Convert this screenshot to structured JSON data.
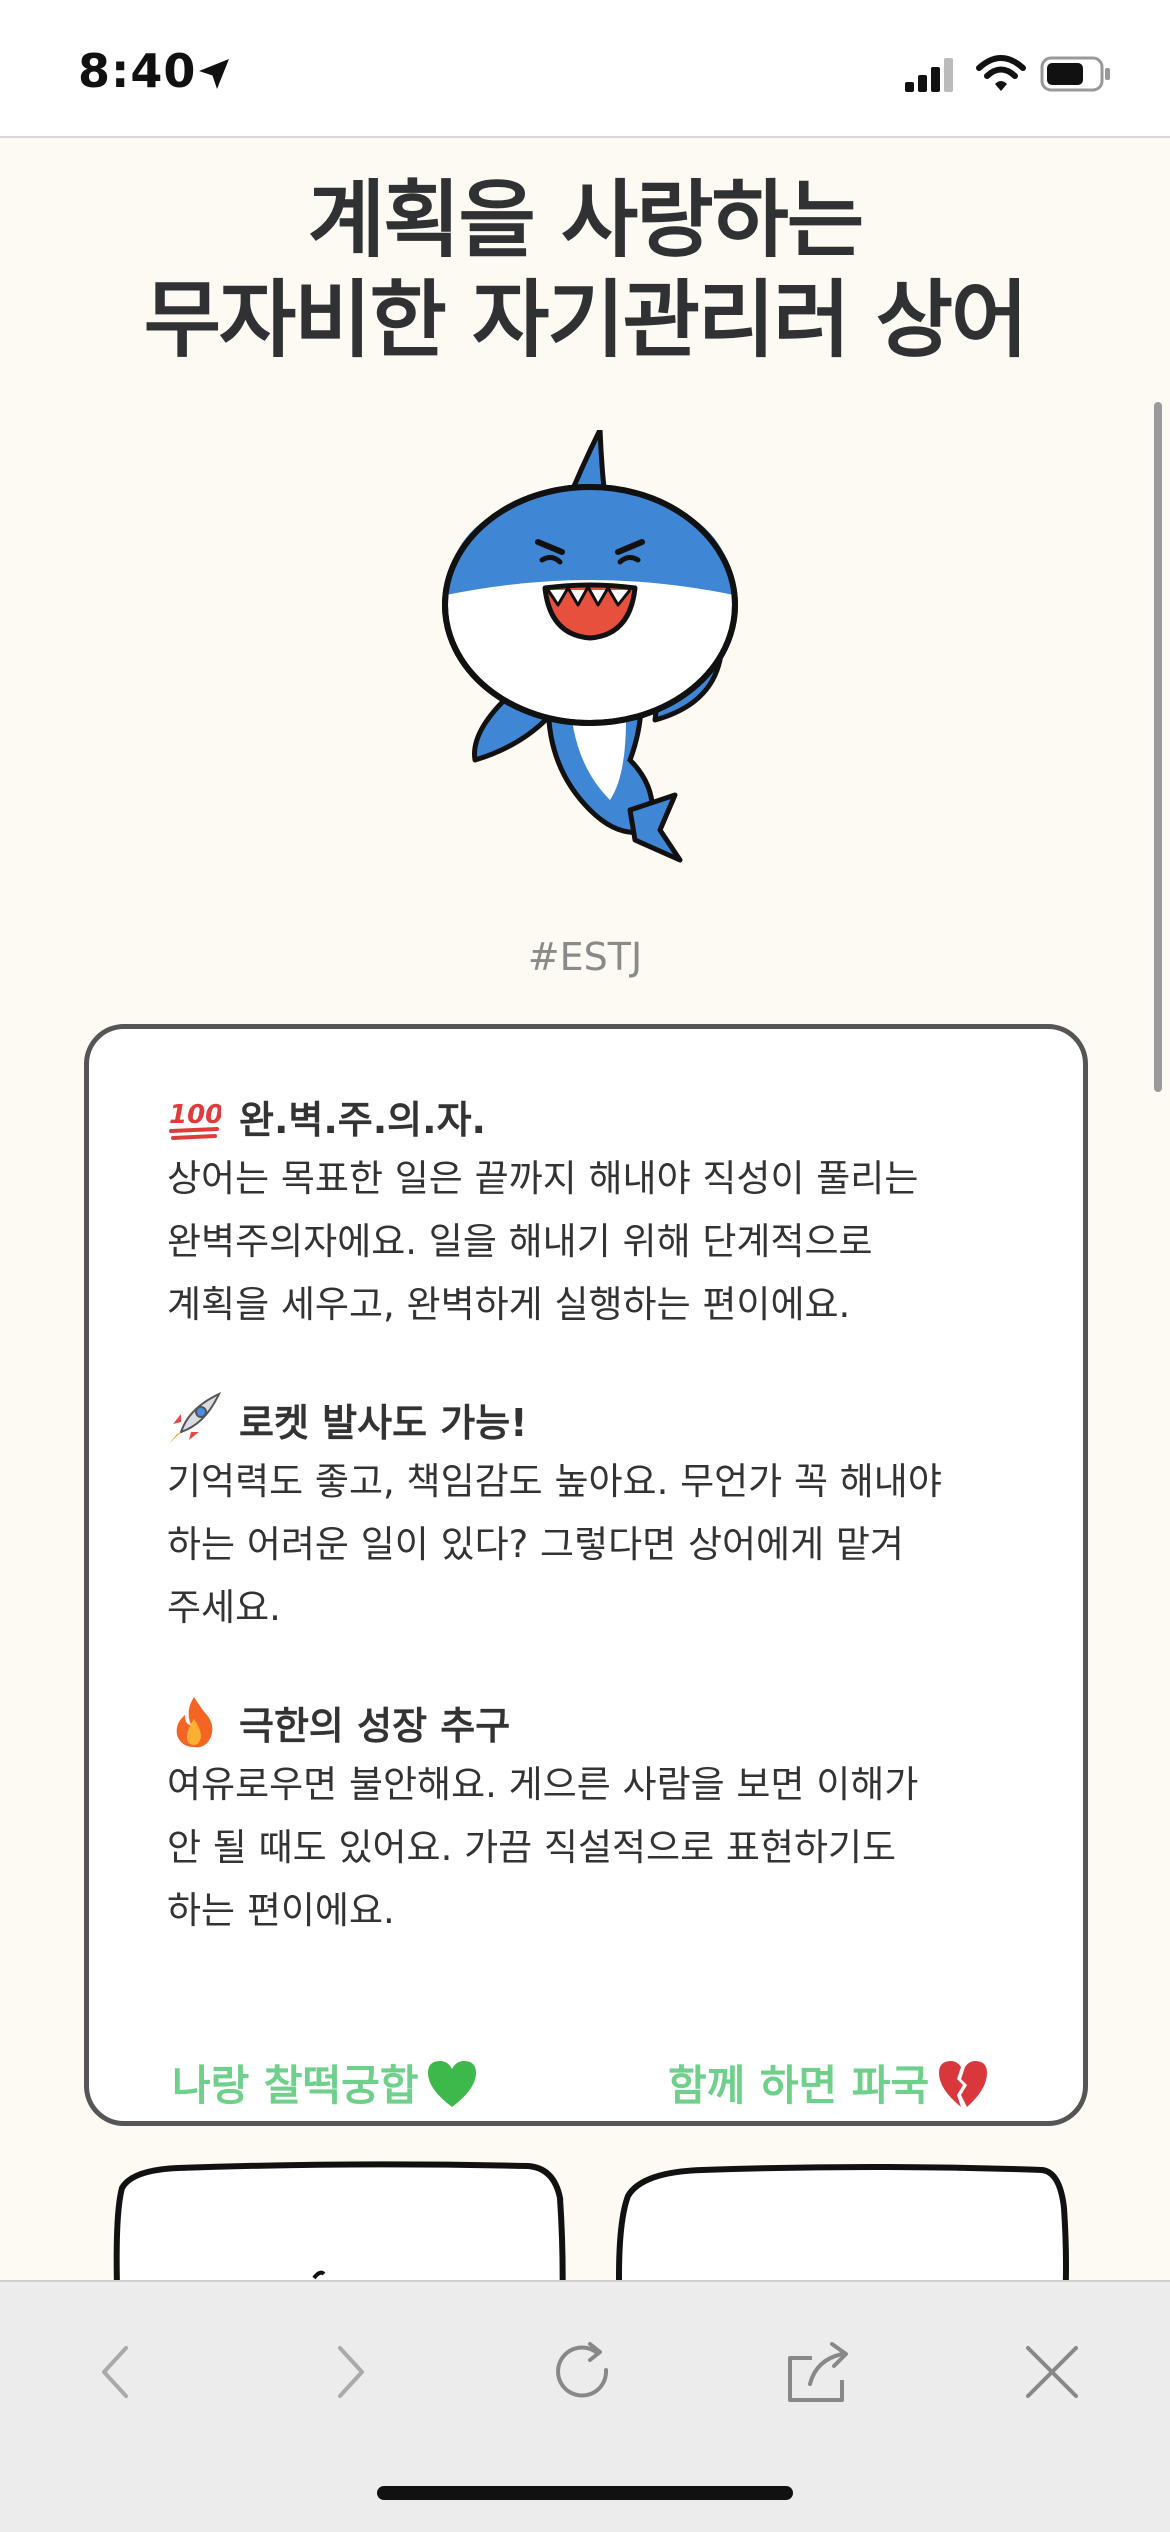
{
  "status": {
    "time": "8:40"
  },
  "title": {
    "line1": "계획을 사랑하는",
    "line2": "무자비한 자기관리러 상어"
  },
  "hashtag": "#ESTJ",
  "sections": [
    {
      "emoji": "hundred-points-icon",
      "heading": "완.벽.주.의.자.",
      "lines": [
        "상어는 목표한 일은 끝까지 해내야 직성이 풀리는",
        "완벽주의자에요. 일을 해내기 위해 단계적으로",
        "계획을 세우고, 완벽하게 실행하는 편이에요."
      ]
    },
    {
      "emoji": "rocket-icon",
      "heading": "로켓 발사도 가능!",
      "lines": [
        "기억력도 좋고, 책임감도 높아요. 무언가 꼭 해내야",
        "하는 어려운 일이 있다? 그렇다면 상어에게 맡겨",
        "주세요."
      ]
    },
    {
      "emoji": "fire-icon",
      "heading": "극한의 성장 추구",
      "lines": [
        "여유로우면 불안해요. 게으른 사람을 보면 이해가",
        "안 될 때도 있어요. 가끔 직설적으로 표현하기도",
        "하는 편이에요."
      ]
    }
  ],
  "match": {
    "good": "나랑 찰떡궁합",
    "bad": "함께 하면 파국"
  },
  "colors": {
    "accent": "#6ed08a",
    "shark_blue": "#3f86d4",
    "background": "#fdf9f3"
  }
}
